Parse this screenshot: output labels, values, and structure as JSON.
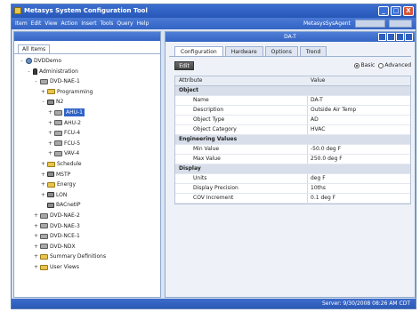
{
  "window": {
    "title": "Metasys System Configuration Tool",
    "icon": "app-icon",
    "controls": {
      "minimize": "_",
      "maximize": "□",
      "close": "X"
    }
  },
  "menubar": {
    "items": [
      "Item",
      "Edit",
      "View",
      "Action",
      "Insert",
      "Tools",
      "Query",
      "Help"
    ],
    "user": "MetasysSysAgent"
  },
  "left_pane": {
    "tab": "All Items",
    "tree": [
      {
        "label": "DVDDemo",
        "icon": "globe-icon",
        "toggle": "-",
        "depth": 0
      },
      {
        "label": "Administration",
        "icon": "person-icon",
        "toggle": "-",
        "depth": 1
      },
      {
        "label": "DVD-NAE-1",
        "icon": "device-icon",
        "toggle": "-",
        "depth": 2
      },
      {
        "label": "Programming",
        "icon": "folder-icon",
        "toggle": "+",
        "depth": 3
      },
      {
        "label": "N2",
        "icon": "link-icon",
        "toggle": "-",
        "depth": 3
      },
      {
        "label": "AHU-1",
        "icon": "device-icon",
        "toggle": "+",
        "depth": 4,
        "selected": true
      },
      {
        "label": "AHU-2",
        "icon": "device-icon",
        "toggle": "+",
        "depth": 4
      },
      {
        "label": "FCU-4",
        "icon": "device-icon",
        "toggle": "+",
        "depth": 4
      },
      {
        "label": "FCU-5",
        "icon": "device-icon",
        "toggle": "+",
        "depth": 4
      },
      {
        "label": "VAV-4",
        "icon": "device-icon",
        "toggle": "+",
        "depth": 4
      },
      {
        "label": "Schedule",
        "icon": "folder-icon",
        "toggle": "+",
        "depth": 3
      },
      {
        "label": "MSTP",
        "icon": "link-icon",
        "toggle": "+",
        "depth": 3
      },
      {
        "label": "Energy",
        "icon": "folder-icon",
        "toggle": "+",
        "depth": 3
      },
      {
        "label": "LON",
        "icon": "link-icon",
        "toggle": "+",
        "depth": 3
      },
      {
        "label": "BACnetIP",
        "icon": "link-icon",
        "toggle": "",
        "depth": 3
      },
      {
        "label": "DVD-NAE-2",
        "icon": "device-icon",
        "toggle": "+",
        "depth": 2
      },
      {
        "label": "DVD-NAE-3",
        "icon": "device-icon",
        "toggle": "+",
        "depth": 2
      },
      {
        "label": "DVD-NCE-1",
        "icon": "device-icon",
        "toggle": "+",
        "depth": 2
      },
      {
        "label": "DVD-NDX",
        "icon": "device-icon",
        "toggle": "+",
        "depth": 2
      },
      {
        "label": "Summary Definitions",
        "icon": "folder-icon",
        "toggle": "+",
        "depth": 2
      },
      {
        "label": "User Views",
        "icon": "folder-icon",
        "toggle": "+",
        "depth": 2
      }
    ]
  },
  "right_pane": {
    "title": "DA-T",
    "tabs": [
      "Configuration",
      "Hardware",
      "Options",
      "Trend"
    ],
    "active_tab": "Configuration",
    "edit_label": "Edit",
    "view_modes": [
      {
        "label": "Basic",
        "selected": true
      },
      {
        "label": "Advanced",
        "selected": false
      }
    ],
    "columns": [
      "Attribute",
      "Value"
    ],
    "groups": [
      {
        "name": "Object",
        "rows": [
          {
            "attr": "Name",
            "value": "DA-T"
          },
          {
            "attr": "Description",
            "value": "Outside Air Temp"
          },
          {
            "attr": "Object Type",
            "value": "AD"
          },
          {
            "attr": "Object Category",
            "value": "HVAC"
          }
        ]
      },
      {
        "name": "Engineering Values",
        "rows": [
          {
            "attr": "Min Value",
            "value": "-50.0 deg F"
          },
          {
            "attr": "Max Value",
            "value": "250.0 deg F"
          }
        ]
      },
      {
        "name": "Display",
        "rows": [
          {
            "attr": "Units",
            "value": "deg F"
          },
          {
            "attr": "Display Precision",
            "value": "10ths"
          },
          {
            "attr": "COV Increment",
            "value": "0.1 deg F"
          }
        ]
      }
    ]
  },
  "status_bar": {
    "text": "Server: 9/30/2008 08:26 AM CDT"
  },
  "colors": {
    "title_bar": "#2f63c7",
    "selection": "#2f63c7",
    "panel_bg": "#eef2f8"
  }
}
